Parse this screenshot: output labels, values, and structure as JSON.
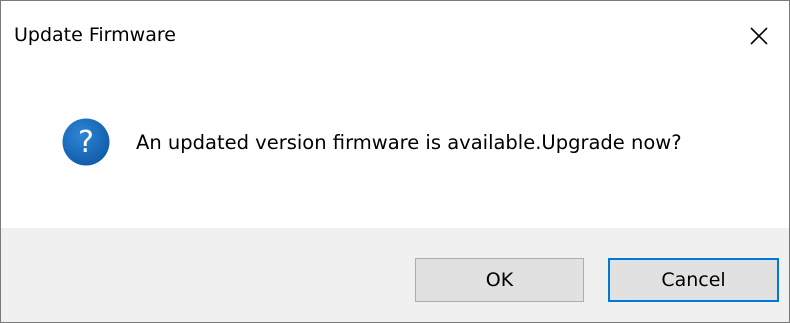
{
  "dialog": {
    "title": "Update Firmware",
    "message": "An updated version firmware is available.Upgrade now?",
    "icon": "question-icon",
    "buttons": {
      "ok_label": "OK",
      "cancel_label": "Cancel"
    },
    "focused_button": "Cancel",
    "colors": {
      "accent": "#0078d7",
      "icon_blue": "#1764b7",
      "footer_bg": "#f0f0f0",
      "button_bg": "#e1e1e1"
    }
  }
}
